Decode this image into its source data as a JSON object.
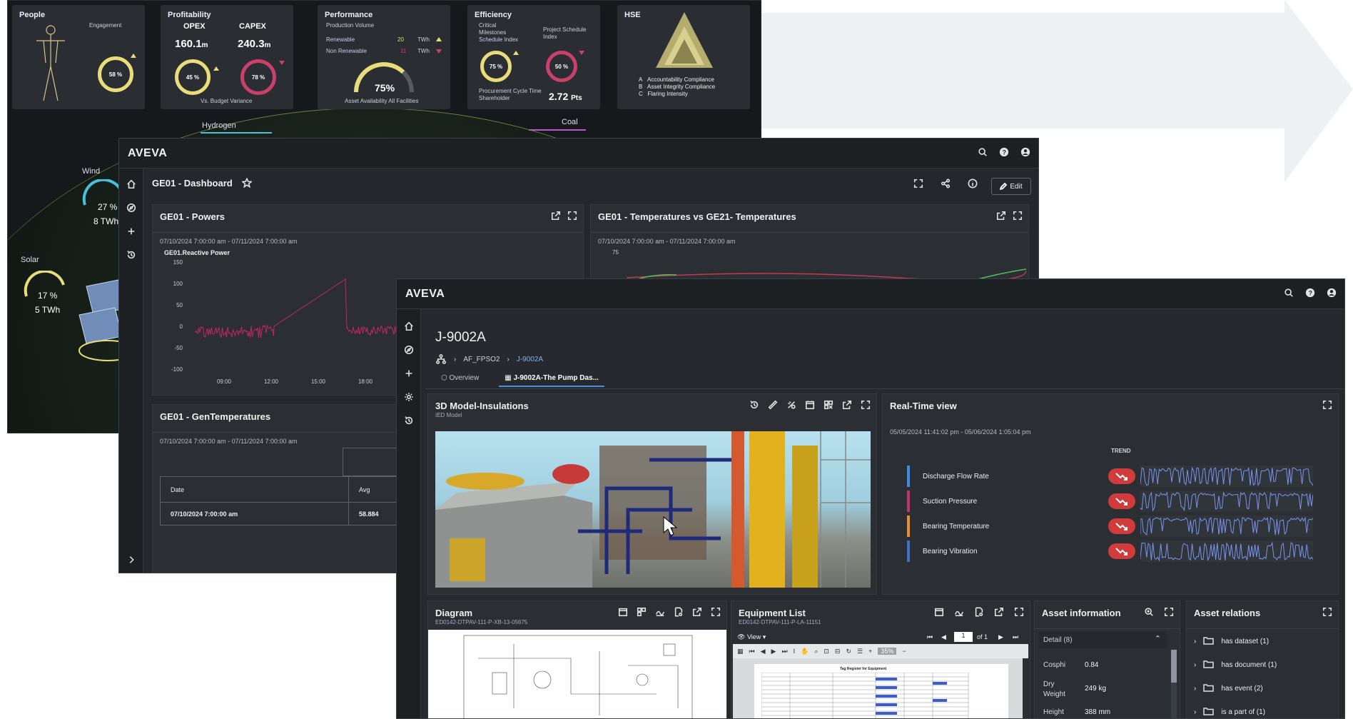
{
  "kpi": {
    "people": {
      "title": "People",
      "engagement_label": "Engagement",
      "engagement_value": "58 %"
    },
    "profitability": {
      "title": "Profitability",
      "opex_label": "OPEX",
      "opex_value": "160.1",
      "opex_unit": "m",
      "opex_pct": "45 %",
      "capex_label": "CAPEX",
      "capex_value": "240.3",
      "capex_unit": "m",
      "capex_pct": "78 %",
      "footer": "Vs. Budget Variance"
    },
    "performance": {
      "title": "Performance",
      "subtitle": "Production Volume",
      "renewable_label": "Renewable",
      "renewable_value": "20",
      "renewable_unit": "TWh",
      "nonrenewable_label": "Non Renewable",
      "nonrenewable_value": "11",
      "nonrenewable_unit": "TWh",
      "availability_value": "75%",
      "footer": "Asset Availability All Facilities"
    },
    "efficiency": {
      "title": "Efficiency",
      "critical_label": "Critical Milestones Schedule Index",
      "critical_value": "75 %",
      "project_label": "Project Schedule Index",
      "project_value": "50 %",
      "procurement_label": "Procurement Cycle Time Shareholder",
      "procurement_value": "2.72",
      "procurement_unit": "Pts"
    },
    "hse": {
      "title": "HSE",
      "items": [
        {
          "key": "A",
          "label": "Accountability Compliance"
        },
        {
          "key": "B",
          "label": "Asset Integrity Compliance"
        },
        {
          "key": "C",
          "label": "Flaring Intensity"
        }
      ]
    }
  },
  "energy": {
    "hydrogen": "Hydrogen",
    "coal": "Coal",
    "wind": {
      "label": "Wind",
      "pct": "27 %",
      "twh": "8 TWh"
    },
    "solar": {
      "label": "Solar",
      "pct": "17 %",
      "twh": "5 TWh"
    }
  },
  "dashboard": {
    "brand": "AVEVA",
    "title": "GE01 - Dashboard",
    "edit_label": "Edit",
    "powers": {
      "title": "GE01 - Powers",
      "date_range": "07/10/2024 7:00:00 am - 07/11/2024 7:00:00 am",
      "series_label": "GE01.Reactive Power",
      "y_ticks": [
        "150",
        "100",
        "50",
        "0",
        "-50",
        "-100"
      ],
      "x_ticks": [
        "09:00",
        "12:00",
        "15:00",
        "18:00"
      ]
    },
    "temps": {
      "title": "GE01 - Temperatures vs GE21- Temperatures",
      "date_range": "07/10/2024 7:00:00 am - 07/11/2024 7:00:00 am",
      "y_top": "75"
    },
    "gentemps": {
      "title": "GE01 - GenTemperatures",
      "date_range": "07/10/2024 7:00:00 am - 07/11/2024 7:00:00 am",
      "col_date": "Date",
      "col_avg": "Avg",
      "row_date": "07/10/2024 7:00:00 am",
      "row_avg": "58.884"
    }
  },
  "asset": {
    "brand": "AVEVA",
    "title": "J-9002A",
    "breadcrumb": [
      "AF_FPSO2",
      "J-9002A"
    ],
    "tabs": [
      "Overview",
      "J-9002A-The Pump Das..."
    ],
    "model": {
      "title": "3D Model-Insulations",
      "subtitle": "IED Model"
    },
    "realtime": {
      "title": "Real-Time view",
      "date_range": "05/05/2024 11:41:02 pm - 05/06/2024 1:05:04 pm",
      "trend_label": "TREND",
      "rows": [
        {
          "label": "Discharge Flow Rate",
          "color": "#3a8ee6"
        },
        {
          "label": "Suction Pressure",
          "color": "#c0336b"
        },
        {
          "label": "Bearing Temperature",
          "color": "#e8902f"
        },
        {
          "label": "Bearing Vibration",
          "color": "#3a72c9"
        }
      ]
    },
    "diagram": {
      "title": "Diagram",
      "subtitle": "ED0142-DTPAV-111-P-XB-13-05675"
    },
    "equipment": {
      "title": "Equipment List",
      "subtitle": "ED0142-DTPAV-111-P-LA-11151",
      "view_label": "View",
      "page_value": "1",
      "page_of": "of 1",
      "zoom": "35%",
      "doc_heading": "Tag Register for Equipment"
    },
    "info": {
      "title": "Asset information",
      "section": "Detail (8)",
      "rows": [
        {
          "label": "Cosphi",
          "value": "0.84"
        },
        {
          "label": "Dry Weight",
          "value": "249 kg"
        },
        {
          "label": "Height",
          "value": "388 mm"
        }
      ]
    },
    "relations": {
      "title": "Asset relations",
      "items": [
        "has dataset (1)",
        "has document (1)",
        "has event (2)",
        "is a part of (1)"
      ]
    }
  }
}
